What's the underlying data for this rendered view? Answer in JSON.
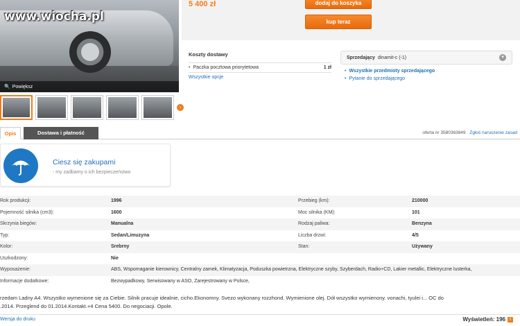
{
  "gallery": {
    "watermark": "www.wiocha.pl",
    "zoom_label": "Powiększ",
    "zoom_icon": "magnifier-icon",
    "thumb_count": 5
  },
  "offer": {
    "price": "5 400 zł",
    "add_to_cart": "dodaj do koszyka",
    "buy_now": "kup teraz"
  },
  "shipping": {
    "title": "Koszty dostawy",
    "method": "Paczka pocztowa priorytetowa",
    "cost": "1 zł",
    "all_options": "Wszystkie opcje"
  },
  "seller": {
    "label": "Sprzedający",
    "name": "dinamit-c (-1)",
    "all_items": "Wszystkie przedmioty sprzedającego",
    "ask": "Pytanie do sprzedającego"
  },
  "tabs": [
    "Opis",
    "Dostawa i płatność"
  ],
  "offer_meta": {
    "offer_number": "oferta nr 3580363849",
    "report": "Zgłoś naruszenie zasad"
  },
  "banner": {
    "title": "Ciesz się zakupami",
    "subtitle": "- my zadbamy o ich bezpieczeństwo"
  },
  "specs": [
    {
      "l1": "Rok produkcji:",
      "v1": "1996",
      "l2": "Przebieg (km):",
      "v2": "210000"
    },
    {
      "l1": "Pojemność silnika (cm3):",
      "v1": "1600",
      "l2": "Moc silnika (KM):",
      "v2": "101"
    },
    {
      "l1": "Skrzynia biegów:",
      "v1": "Manualna",
      "l2": "Rodzaj paliwa:",
      "v2": "Benzyna"
    },
    {
      "l1": "Typ:",
      "v1": "Sedan/Limuzyna",
      "l2": "Liczba drzwi:",
      "v2": "4/5"
    },
    {
      "l1": "Kolor:",
      "v1": "Srebrny",
      "l2": "Stan:",
      "v2": "Używany"
    },
    {
      "l1": "Uszkodzony:",
      "v1": "Nie",
      "l2": "",
      "v2": ""
    },
    {
      "l1": "Wyposażenie:",
      "v1": "ABS, Wspomaganie kierownicy, Centralny zamek, Klimatyzacja, Poduszka powietrzna, Elektryczne szyby, Szyberdach, Radio+CD, Lakier metallic, Elektryczne lusterka,",
      "l2": "",
      "v2": ""
    },
    {
      "l1": "Informacje dodatkowe:",
      "v1": "Bezwypadkowy, Serwisowany w ASO, Zarejestrowany w Polsce,",
      "l2": "",
      "v2": ""
    }
  ],
  "description": {
    "line1": "rzedam Ladny A4. Wszystko wymenione się za Ciebie. Silnik pracuje idealnie, cicho.Ekonomny. Svezo wykonany rozzhond. Wymienione olej. Dół wszystko wymienony. vonachi, tyulei i... OC do",
    "line2": ".2014. Przeglend do 01.2014.Kontakt.+4            Cena 5400. Do negociacji. Opole."
  },
  "footer": {
    "print": "Wersja do druku",
    "views": "Wyświetleń: 196"
  },
  "colors": {
    "accent": "#f07d1a",
    "link": "#1f6fb8",
    "banner_icon_bg": "#1f78c4"
  }
}
